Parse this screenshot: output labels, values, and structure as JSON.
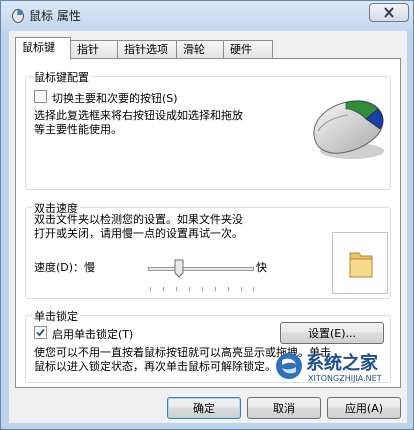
{
  "window": {
    "title": "鼠标 属性"
  },
  "tabs": [
    {
      "label": "鼠标键"
    },
    {
      "label": "指针"
    },
    {
      "label": "指针选项"
    },
    {
      "label": "滑轮"
    },
    {
      "label": "硬件"
    }
  ],
  "button_config": {
    "group_title": "鼠标键配置",
    "switch_label": "切换主要和次要的按钮(S)",
    "switch_checked": false,
    "description_line1": "选择此复选框来将右按钮设成如选择和拖放",
    "description_line2": "等主要性能使用。"
  },
  "double_click": {
    "group_title": "双击速度",
    "description_line1": "双击文件夹以检测您的设置。如果文件夹没",
    "description_line2": "打开或关闭，请用慢一点的设置再试一次。",
    "speed_label": "速度(D)：慢",
    "fast_label": "快",
    "speed_level_fraction": 0.33
  },
  "click_lock": {
    "group_title": "单击锁定",
    "enable_label": "启用单击锁定(T)",
    "enable_checked": true,
    "settings_button": "设置(E)...",
    "description_line1": "使您可以不用一直按着鼠标按钮就可以高亮显示或拖拽。单击",
    "description_line2": "鼠标以进入锁定状态，再次单击鼠标可解除锁定。"
  },
  "footer": {
    "ok": "确定",
    "cancel": "取消",
    "apply": "应用(A)"
  },
  "watermark": {
    "text": "系统之家",
    "url": "XITONGZHIJIA.NET"
  },
  "icons": {
    "window": "mouse-icon",
    "close": "close-icon",
    "mouse_illustration": "mouse-illustration",
    "folder": "folder-icon"
  },
  "colors": {
    "titlebar": "#c3d7ee",
    "panel": "#ffffff",
    "close_x": "#2b3d55"
  }
}
